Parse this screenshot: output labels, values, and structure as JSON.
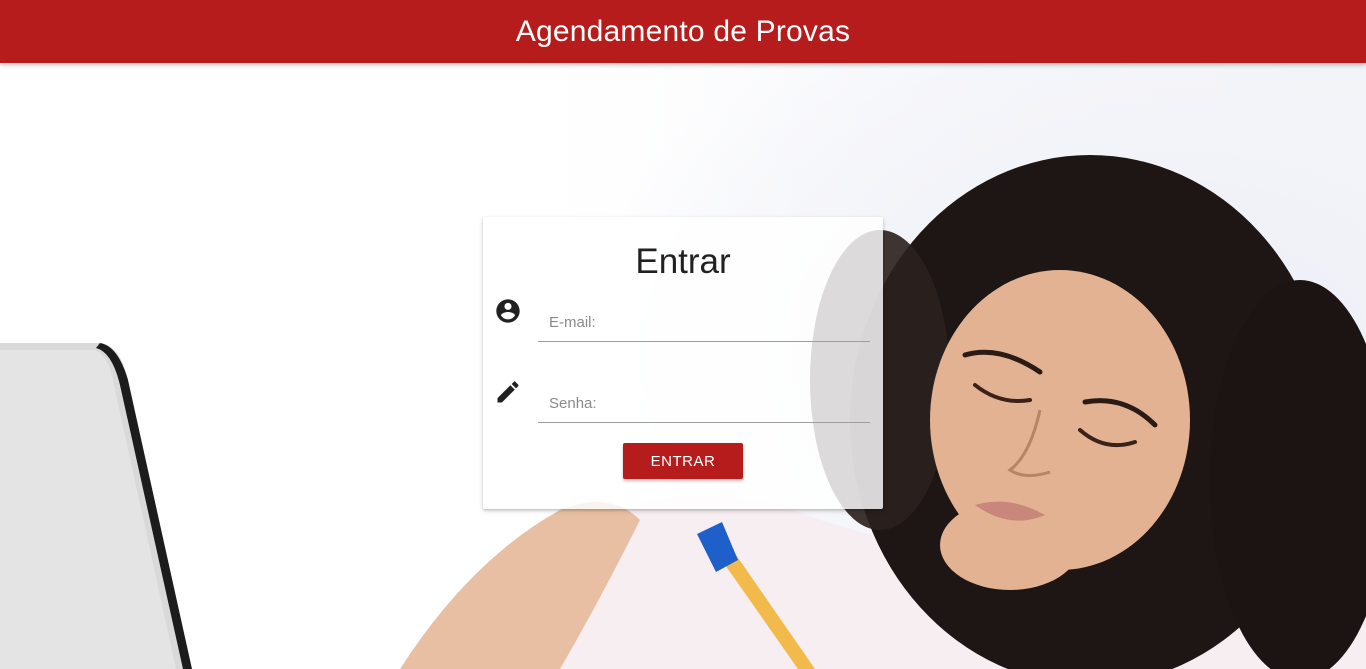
{
  "header": {
    "title": "Agendamento de Provas"
  },
  "login": {
    "title": "Entrar",
    "email_placeholder": "E-mail:",
    "password_placeholder": "Senha:",
    "submit_label": "ENTRAR",
    "icons": {
      "email": "account-circle-icon",
      "password": "pencil-icon"
    }
  },
  "colors": {
    "brand": "#b71c1c",
    "header_text": "#ffffff",
    "card_bg": "#ffffff"
  }
}
